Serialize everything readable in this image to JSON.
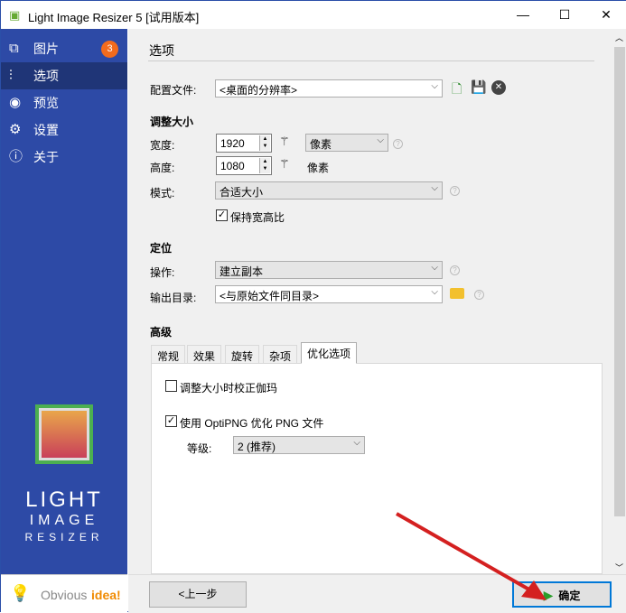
{
  "window": {
    "title": "Light Image Resizer 5  [试用版本]",
    "minimize": "—",
    "maximize": "☐",
    "close": "✕"
  },
  "sidebar": {
    "items": [
      {
        "label": "图片",
        "icon": "images-icon",
        "badge": "3"
      },
      {
        "label": "选项",
        "icon": "sliders-icon"
      },
      {
        "label": "预览",
        "icon": "eye-icon"
      },
      {
        "label": "设置",
        "icon": "gear-icon"
      },
      {
        "label": "关于",
        "icon": "info-icon"
      }
    ],
    "logo": [
      "LIGHT",
      "IMAGE",
      "RESIZER"
    ],
    "brand": {
      "a": "Obvious",
      "b": "idea!"
    }
  },
  "main": {
    "title": "选项",
    "profile": {
      "label": "配置文件:",
      "value": "<桌面的分辨率>"
    },
    "resize": {
      "heading": "调整大小",
      "width_label": "宽度:",
      "width": "1920",
      "unit": "像素",
      "height_label": "高度:",
      "height": "1080",
      "unit2": "像素",
      "mode_label": "模式:",
      "mode": "合适大小",
      "keep_ratio": "保持宽高比"
    },
    "position": {
      "heading": "定位",
      "action_label": "操作:",
      "action": "建立副本",
      "output_label": "输出目录:",
      "output": "<与原始文件同目录>"
    },
    "advanced": {
      "heading": "高级",
      "tabs": [
        "常规",
        "效果",
        "旋转",
        "杂项",
        "优化选项"
      ],
      "gamma": "调整大小时校正伽玛",
      "optipng": "使用 OptiPNG 优化 PNG 文件",
      "level_label": "等级:",
      "level": "2 (推荐)"
    }
  },
  "footer": {
    "back": "<上一步",
    "ok": "确定"
  },
  "colors": {
    "sidebar": "#2d4aa6",
    "selected": "#1f3577",
    "badge": "#f26b1d"
  }
}
